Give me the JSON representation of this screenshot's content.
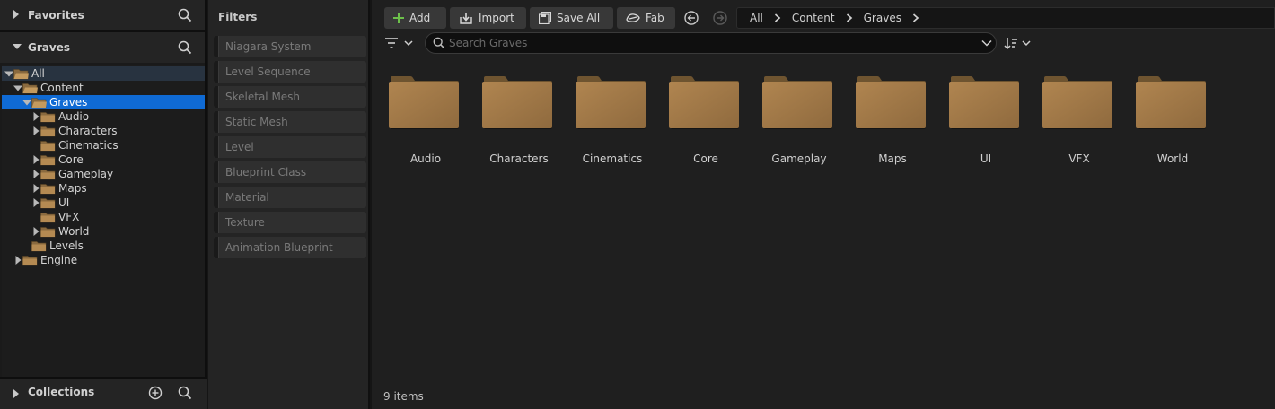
{
  "sources": {
    "favorites_title": "Favorites",
    "graves_title": "Graves",
    "collections_title": "Collections",
    "tree": [
      {
        "label": "All",
        "depth": 0,
        "arrow": "down",
        "open": true,
        "state": "hl"
      },
      {
        "label": "Content",
        "depth": 1,
        "arrow": "down",
        "open": true,
        "state": ""
      },
      {
        "label": "Graves",
        "depth": 2,
        "arrow": "down",
        "open": true,
        "state": "sel"
      },
      {
        "label": "Audio",
        "depth": 3,
        "arrow": "right",
        "open": false,
        "state": ""
      },
      {
        "label": "Characters",
        "depth": 3,
        "arrow": "right",
        "open": false,
        "state": ""
      },
      {
        "label": "Cinematics",
        "depth": 3,
        "arrow": "",
        "open": false,
        "state": ""
      },
      {
        "label": "Core",
        "depth": 3,
        "arrow": "right",
        "open": false,
        "state": ""
      },
      {
        "label": "Gameplay",
        "depth": 3,
        "arrow": "right",
        "open": false,
        "state": ""
      },
      {
        "label": "Maps",
        "depth": 3,
        "arrow": "right",
        "open": false,
        "state": ""
      },
      {
        "label": "UI",
        "depth": 3,
        "arrow": "right",
        "open": false,
        "state": ""
      },
      {
        "label": "VFX",
        "depth": 3,
        "arrow": "",
        "open": false,
        "state": ""
      },
      {
        "label": "World",
        "depth": 3,
        "arrow": "right",
        "open": false,
        "state": ""
      },
      {
        "label": "Levels",
        "depth": 2,
        "arrow": "",
        "open": false,
        "state": ""
      },
      {
        "label": "Engine",
        "depth": 1,
        "arrow": "right",
        "open": false,
        "state": ""
      }
    ]
  },
  "filters": {
    "title": "Filters",
    "items": [
      "Niagara System",
      "Level Sequence",
      "Skeletal Mesh",
      "Static Mesh",
      "Level",
      "Blueprint Class",
      "Material",
      "Texture",
      "Animation Blueprint"
    ]
  },
  "toolbar": {
    "add_label": "Add",
    "import_label": "Import",
    "save_all_label": "Save All",
    "fab_label": "Fab"
  },
  "breadcrumb": [
    "All",
    "Content",
    "Graves"
  ],
  "search": {
    "placeholder": "Search Graves"
  },
  "assets": [
    "Audio",
    "Characters",
    "Cinematics",
    "Core",
    "Gameplay",
    "Maps",
    "UI",
    "VFX",
    "World"
  ],
  "status": {
    "item_count": "9 items"
  },
  "colors": {
    "selection": "#0f6ad4",
    "folder": "#a47c4a",
    "add_icon": "#6cc04a"
  },
  "icons": {
    "search": "search-icon",
    "chevron": "chevron-icon",
    "folder": "folder-icon",
    "add": "plus-icon",
    "import": "import-icon",
    "save": "save-icon",
    "fab": "fab-icon",
    "back": "back-arrow-icon",
    "forward": "forward-arrow-icon",
    "filter": "filter-icon",
    "sort": "sort-icon",
    "add_collection": "add-circle-icon"
  }
}
